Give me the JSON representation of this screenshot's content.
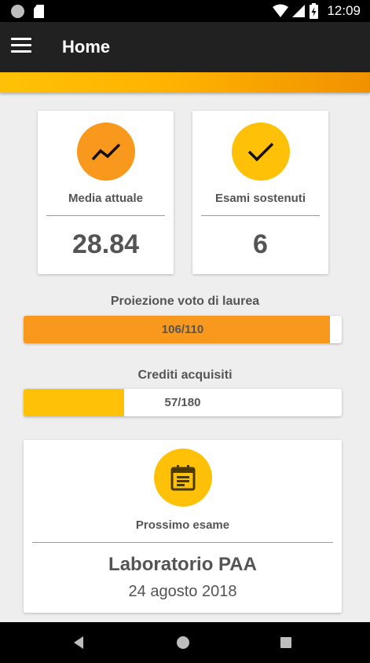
{
  "app": {
    "title": "Home",
    "accent_color": "#f09200",
    "secondary_color": "#ffc107"
  },
  "status_bar": {
    "time": "12:09",
    "icons": [
      "notification-circle-icon",
      "sd-card-icon",
      "wifi-icon",
      "signal-icon",
      "battery-charging-icon"
    ]
  },
  "stats": {
    "media": {
      "label": "Media attuale",
      "value": "28.84",
      "icon": "trending-up-icon",
      "color": "#f8981d"
    },
    "esami": {
      "label": "Esami sostenuti",
      "value": "6",
      "icon": "check-icon",
      "color": "#ffc107"
    }
  },
  "projection": {
    "label": "Proiezione voto di laurea",
    "text": "106/110",
    "progress": 0.964,
    "color": "#f8981d"
  },
  "credits": {
    "label": "Crediti acquisiti",
    "text": "57/180",
    "progress": 0.317,
    "color": "#ffc107"
  },
  "next_exam": {
    "label": "Prossimo esame",
    "name": "Laboratorio PAA",
    "date": "24 agosto 2018",
    "icon": "calendar-icon"
  },
  "nav_bar": {
    "buttons": [
      "back-icon",
      "home-icon",
      "recents-icon"
    ]
  }
}
